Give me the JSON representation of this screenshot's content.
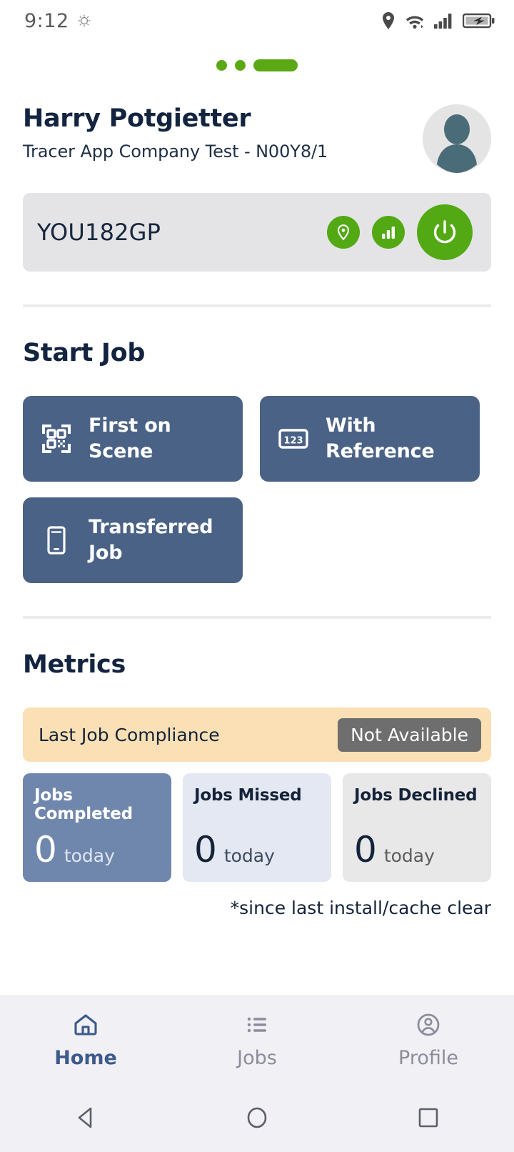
{
  "status_bar": {
    "time": "9:12",
    "icons": [
      "brightness-sun-icon",
      "location-pin-icon",
      "wifi-icon",
      "cellular-signal-icon",
      "battery-charging-icon"
    ]
  },
  "pager": {
    "dots": [
      "inactive",
      "inactive",
      "active"
    ],
    "active_color": "#5AA914"
  },
  "profile": {
    "name": "Harry Potgietter",
    "company": "Tracer App Company Test - N00Y8/1",
    "avatar_icon": "user-avatar-icon",
    "vehicle": {
      "registration": "YOU182GP",
      "actions": [
        {
          "name": "location-pin-icon",
          "label": "Location"
        },
        {
          "name": "signal-bars-icon",
          "label": "Signal"
        },
        {
          "name": "power-icon",
          "label": "Power"
        }
      ],
      "accent_color": "#52A914"
    }
  },
  "start_job": {
    "title": "Start Job",
    "buttons": [
      {
        "label": "First on Scene",
        "icon": "qr-code-scan-icon"
      },
      {
        "label": "With Reference",
        "icon": "numeric-123-icon"
      },
      {
        "label": "Transferred Job",
        "icon": "mobile-phone-icon"
      }
    ],
    "button_color": "#4A6285"
  },
  "metrics": {
    "title": "Metrics",
    "compliance": {
      "label": "Last Job Compliance",
      "status": "Not Available",
      "banner_color": "#FAE0B4",
      "badge_color": "#6E6E6E"
    },
    "cards": [
      {
        "label": "Jobs Completed",
        "value": "0",
        "unit": "today",
        "color": "#7087AD"
      },
      {
        "label": "Jobs Missed",
        "value": "0",
        "unit": "today",
        "color": "#E3E8F2"
      },
      {
        "label": "Jobs Declined",
        "value": "0",
        "unit": "today",
        "color": "#E9E8E8"
      }
    ],
    "footnote": "*since last install/cache clear"
  },
  "bottom_nav": {
    "items": [
      {
        "label": "Home",
        "icon": "home-icon",
        "active": true
      },
      {
        "label": "Jobs",
        "icon": "list-icon",
        "active": false
      },
      {
        "label": "Profile",
        "icon": "account-circle-icon",
        "active": false
      }
    ],
    "active_color": "#3C5A8C",
    "inactive_color": "#8b8d9b"
  },
  "system_nav": {
    "buttons": [
      "back-triangle-icon",
      "home-circle-icon",
      "recents-square-icon"
    ]
  }
}
